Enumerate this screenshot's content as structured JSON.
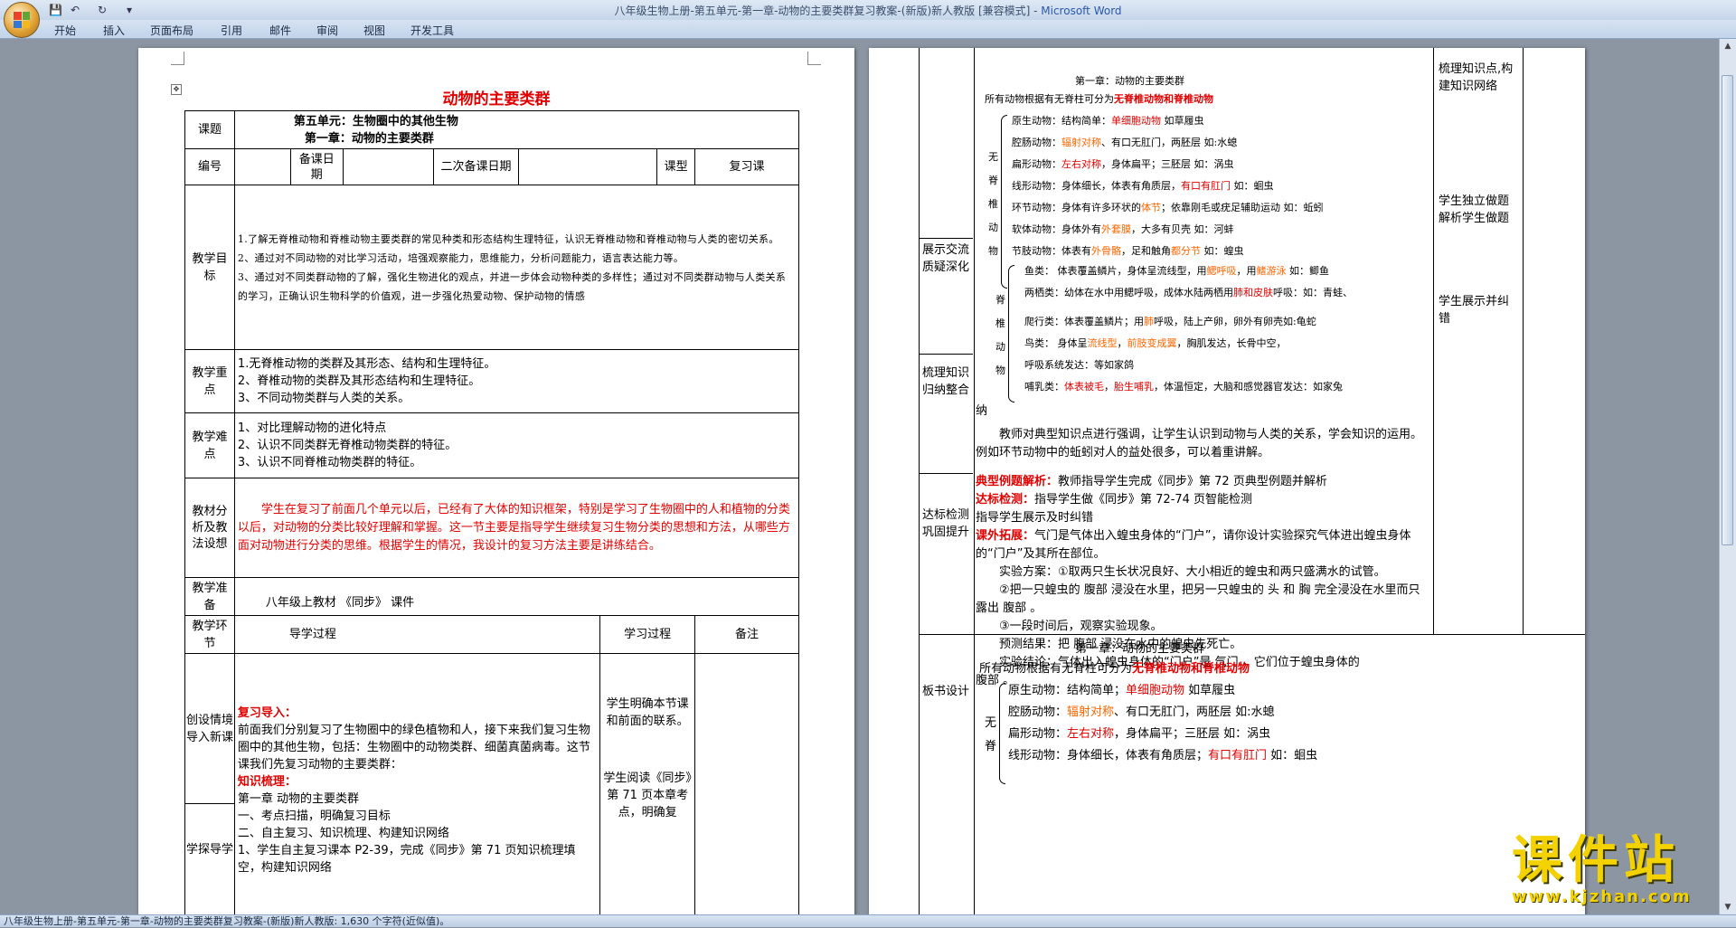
{
  "window": {
    "title": "八年级生物上册-第五单元-第一章-动物的主要类群复习教案-(新版)新人教版 [兼容模式] - ",
    "app_name": "Microsoft Word"
  },
  "qat": {
    "save": "💾",
    "undo": "↶",
    "redo": "↻",
    "more": "▾"
  },
  "ribbon_tabs": [
    "开始",
    "插入",
    "页面布局",
    "引用",
    "邮件",
    "审阅",
    "视图",
    "开发工具"
  ],
  "status": "八年级生物上册-第五单元-第一章-动物的主要类群复习教案-(新版)新人教版: 1,630 个字符(近似值)。",
  "watermark": {
    "text": "课件站",
    "url": "www.kjzhan.com"
  },
  "page1": {
    "title": "动物的主要类群",
    "rows": {
      "topic_label": "课题",
      "topic_line1": "第五单元：生物圈中的其他生物",
      "topic_line2": "第一章：动物的主要类群",
      "code_label": "编号",
      "prep_date_label": "备课日期",
      "prep_date2_label": "二次备课日期",
      "lesson_type_label": "课型",
      "lesson_type_value": "复习课",
      "goal_label": "教学目标",
      "goals": [
        "1.了解无脊椎动物和脊椎动物主要类群的常见种类和形态结构生理特征，认识无脊椎动物和脊椎动物与人类的密切关系。",
        "2、通过对不同动物的对比学习活动，培强观察能力，思维能力，分析问题能力，语言表达能力等。",
        "3、通过对不同类群动物的了解，强化生物进化的观点，并进一步体会动物种类的多样性；通过对不同类群动物与人类关系的学习，正确认识生物科学的价值观，进一步强化热爱动物、保护动物的情感"
      ],
      "key_label": "教学重点",
      "keys": [
        "1.无脊椎动物的类群及其形态、结构和生理特征。",
        "2、脊椎动物的类群及其形态结构和生理特征。",
        "3、不同动物类群与人类的关系。"
      ],
      "diff_label": "教学难点",
      "diffs": [
        "1、对比理解动物的进化特点",
        "2、认识不同类群无脊椎动物类群的特征。",
        "3、认识不同脊椎动物类群的特征。"
      ],
      "analysis_label": "教材分析及教法设想",
      "analysis": "学生在复习了前面几个单元以后，已经有了大体的知识框架，特别是学习了生物圈中的人和植物的分类以后，对动物的分类比较好理解和掌握。这一节主要是指导学生继续复习生物分类的思想和方法，从哪些方面对动物进行分类的思维。根据学生的情况，我设计的复习方法主要是讲练结合。",
      "prep_label": "教学准备",
      "prep_value": "八年级上教材  《同步》  课件",
      "step_label": "教学环节",
      "guide_label": "导学过程",
      "process_label": "学习过程",
      "note_label": "备注",
      "step1_label": "创设情境导入新课",
      "step2_label": "学探导学",
      "review_intro_label": "复习导入：",
      "review_intro_text": "前面我们分别复习了生物圈中的绿色植物和人，接下来我们复习生物圈中的其他生物，包括：生物圈中的动物类群、细菌真菌病毒。这节课我们先复习动物的主要类群：",
      "comb_label": "知识梳理：",
      "comb_lines": [
        "第一章  动物的主要类群",
        "一、考点扫描，明确复习目标",
        "二、自主复习、知识梳理、构建知识网络",
        "1、学生自主复习课本 P2-39，完成《同步》第 71 页知识梳理填空，构建知识网络"
      ],
      "process1": "学生明确本节课和前面的联系。",
      "process2": "学生阅读《同步》第 71 页本章考点，明确复"
    }
  },
  "page2": {
    "left_labels": [
      "展示交流质疑深化",
      "梳理知识归纳整合",
      "达标检测巩固提升",
      "板书设计"
    ],
    "right_labels": [
      "梳理知识点,构建知识网络",
      "学生独立做题解析学生做题",
      "学生展示并纠错"
    ],
    "tree_title": "第一章：动物的主要类群",
    "tree_intro": "所有动物根据有无脊柱可分为",
    "tree_intro_red": "无脊椎动物和脊椎动物",
    "invert_group": "无脊椎动物",
    "vert_group": "脊椎动物",
    "invert_items": [
      {
        "pre": "原生动物：结构简单：",
        "hl": "单细胞动物",
        "post": "    如草履虫",
        "color": "red"
      },
      {
        "pre": "腔肠动物：",
        "hl": "辐射对称",
        "post": "、有口无肛门，两胚层  如:水螅",
        "color": "orange"
      },
      {
        "pre": "扁形动物：",
        "hl": "左右对称",
        "post": "，身体扁平；三胚层  如：涡虫",
        "color": "red"
      },
      {
        "pre": "线形动物：身体细长，体表有角质层，",
        "hl": "有口有肛门",
        "post": "   如：蛔虫",
        "color": "red"
      },
      {
        "pre": "环节动物：身体有许多环状的",
        "hl": "体节",
        "post": "；依靠刚毛或疣足辅助运动 如：蚯蚓",
        "color": "orange"
      },
      {
        "pre": "软体动物：身体外有",
        "hl": "外套膜",
        "post": "，大多有贝壳   如：河蚌",
        "color": "orange"
      },
      {
        "pre": "节肢动物：体表有",
        "hl": "外骨骼",
        "post": "，足和触角",
        "color": "orange",
        "hl2": "都分节",
        "post2": "    如：蝗虫"
      }
    ],
    "vert_items": [
      {
        "pre": "鱼类：   体表覆盖鳞片，身体呈流线型，用",
        "hl": "鳃呼吸",
        "mid": "，用",
        "hl2": "鳍游泳",
        "post": "  如：鲫鱼"
      },
      {
        "pre": "两栖类：幼体在水中用鳃呼吸，成体水陆两栖用",
        "hl": "肺和皮肤",
        "post": "呼吸：如：青蛙、"
      },
      {
        "pre": "爬行类：体表覆盖鳞片；用",
        "hl": "肺",
        "post": "呼吸，陆上产卵，卵外有卵壳如:龟蛇"
      },
      {
        "pre": "鸟类：  身体呈",
        "hl": "流线型",
        "mid": "，",
        "hl2": "前肢变成翼",
        "post": "，胸肌发达，长骨中空，"
      },
      {
        "pre": "        呼吸系统发达：等如家鸽",
        "hl": "",
        "post": ""
      },
      {
        "pre": "哺乳类：",
        "hl": "体表被毛",
        "mid": "，",
        "hl2": "胎生哺乳",
        "post": "，体温恒定，大脑和感觉器官发达：如家兔"
      }
    ],
    "consolidate": {
      "end": "纳",
      "teacher": "教师对典型知识点进行强调，让学生认识到动物与人类的关系，学会知识的运用。例如环节动物中的蚯蚓对人的益处很多，可以着重讲解。",
      "typical_label": "典型例题解析：",
      "typical_text": "教师指导学生完成《同步》第 72 页典型例题并解析",
      "check_label": "达标检测：",
      "check_text": "指导学生做《同步》第 72-74 页智能检测",
      "check_text2": "指导学生展示及时纠错",
      "ext_label": "课外拓展：",
      "ext_text": "气门是气体出入蝗虫身体的“门户”，请你设计实验探究气体进出蝗虫身体的“门户”及其所在部位。",
      "plan1": "实验方案：①取两只生长状况良好、大小相近的蝗虫和两只盛满水的试管。",
      "plan2": "②把一只蝗虫的    腹部     浸没在水里，把另一只蝗虫的   头    和    胸   完全浸没在水里而只露出    腹部    。",
      "plan3": "③一段时间后，观察实验现象。",
      "predict": "预测结果：把    腹部    浸没在水中的蝗虫先死亡。",
      "conclude": "实验结论：气体出入蝗虫身体的“门户”是    气门    ，它们位于蝗虫身体的",
      "conclude2": "腹部  。"
    },
    "board": {
      "title": "第一章：动物的主要类群",
      "intro": "所有动物根据有无脊柱可分为",
      "intro_red": "无脊椎动物和脊椎动物",
      "group": "无脊",
      "items": [
        {
          "pre": "原生动物：结构简单；",
          "hl": "单细胞动物",
          "post": "      如草履虫",
          "color": "red"
        },
        {
          "pre": "腔肠动物：",
          "hl": "辐射对称",
          "post": "、有口无肛门，两胚层  如:水螅",
          "color": "orange"
        },
        {
          "pre": "扁形动物：",
          "hl": "左右对称",
          "post": "，身体扁平；三胚层   如：涡虫",
          "color": "red"
        },
        {
          "pre": "线形动物：身体细长，体表有角质层；",
          "hl": "有口有肛门",
          "post": "   如：蛔虫",
          "color": "red"
        }
      ]
    }
  }
}
